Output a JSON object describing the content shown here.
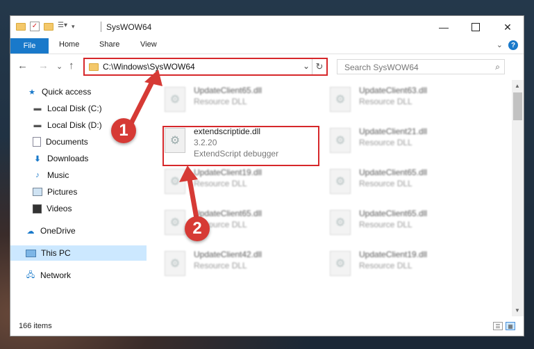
{
  "window": {
    "title": "SysWOW64"
  },
  "ribbon": {
    "file_tab": "File",
    "tabs": [
      "Home",
      "Share",
      "View"
    ],
    "help": "?"
  },
  "address": {
    "path": "C:\\Windows\\SysWOW64",
    "search_placeholder": "Search SysWOW64"
  },
  "nav": {
    "items": [
      {
        "label": "Quick access"
      },
      {
        "label": "Local Disk (C:)"
      },
      {
        "label": "Local Disk (D:)"
      },
      {
        "label": "Documents"
      },
      {
        "label": "Downloads"
      },
      {
        "label": "Music"
      },
      {
        "label": "Pictures"
      },
      {
        "label": "Videos"
      },
      {
        "label": "OneDrive"
      },
      {
        "label": "This PC"
      },
      {
        "label": "Network"
      }
    ]
  },
  "files": [
    {
      "name": "UpdateClient65.dll",
      "type": "Resource DLL"
    },
    {
      "name": "UpdateClient63.dll",
      "type": "Resource DLL"
    },
    {
      "name": "extendscriptide.dll",
      "version": "3.2.20",
      "type": "ExtendScript debugger"
    },
    {
      "name": "UpdateClient21.dll",
      "type": "Resource DLL"
    },
    {
      "name": "UpdateClient19.dll",
      "type": "Resource DLL"
    },
    {
      "name": "UpdateClient65.dll",
      "type": "Resource DLL"
    },
    {
      "name": "UpdateClient65.dll",
      "type": "Resource DLL"
    },
    {
      "name": "UpdateClient65.dll",
      "type": "Resource DLL"
    },
    {
      "name": "UpdateClient42.dll",
      "type": "Resource DLL"
    },
    {
      "name": "UpdateClient19.dll",
      "type": "Resource DLL"
    }
  ],
  "status": {
    "item_count": "166 items"
  },
  "annotations": {
    "step1": "1",
    "step2": "2"
  },
  "colors": {
    "accent": "#1979ca",
    "highlight": "#d6272a",
    "selection": "#cce8ff"
  }
}
